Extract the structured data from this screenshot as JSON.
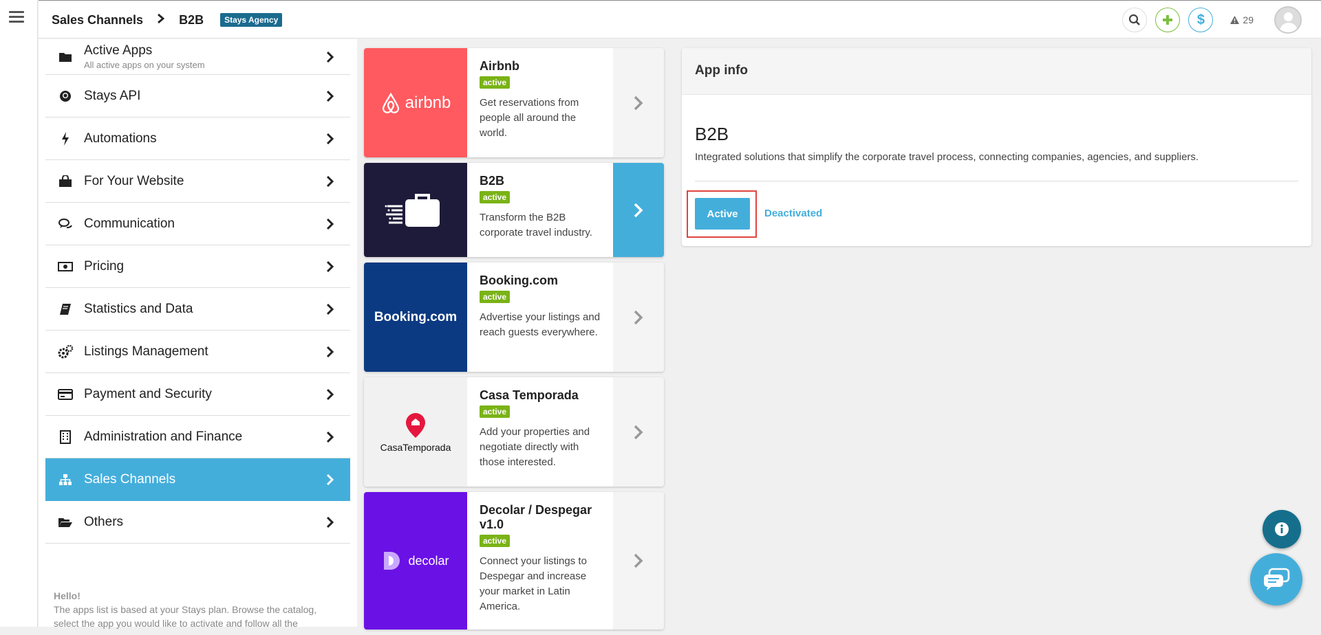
{
  "header": {
    "breadcrumb": [
      "Sales Channels",
      "B2B"
    ],
    "agency_badge": "Stays Agency",
    "alert_count": "29"
  },
  "sidebar": {
    "items": [
      {
        "label": "Active Apps",
        "sub": "All active apps on your system",
        "icon": "folder-icon"
      },
      {
        "label": "Stays API",
        "icon": "github-icon"
      },
      {
        "label": "Automations",
        "icon": "bolt-icon"
      },
      {
        "label": "For Your Website",
        "icon": "shopping-bag-icon"
      },
      {
        "label": "Communication",
        "icon": "chat-bubbles-icon"
      },
      {
        "label": "Pricing",
        "icon": "money-bill-icon"
      },
      {
        "label": "Statistics and Data",
        "icon": "book-icon"
      },
      {
        "label": "Listings Management",
        "icon": "gears-icon"
      },
      {
        "label": "Payment and Security",
        "icon": "credit-card-icon"
      },
      {
        "label": "Administration and Finance",
        "icon": "building-icon"
      },
      {
        "label": "Sales Channels",
        "icon": "sitemap-icon",
        "active": true
      },
      {
        "label": "Others",
        "icon": "folder-open-icon"
      }
    ],
    "hello_title": "Hello!",
    "hello_text": "The apps list is based at your Stays plan. Browse the catalog, select the app you would like to activate and follow all the"
  },
  "apps": [
    {
      "name": "Airbnb",
      "status": "active",
      "desc": "Get reservations from people all around the world.",
      "logo_text": "airbnb",
      "color": "#ff5a5f"
    },
    {
      "name": "B2B",
      "status": "active",
      "desc": "Transform the B2B corporate travel industry.",
      "color": "#1e1b3a",
      "selected": true
    },
    {
      "name": "Booking.com",
      "status": "active",
      "desc": "Advertise your listings and reach guests everywhere.",
      "logo_text": "Booking.com",
      "color": "#0c3a82"
    },
    {
      "name": "Casa Temporada",
      "status": "active",
      "desc": "Add your properties and negotiate directly with those interested.",
      "logo_text": "CasaTemporada",
      "color": "#f1f1f1"
    },
    {
      "name": "Decolar / Despegar v1.0",
      "status": "active",
      "desc": "Connect your listings to Despegar and increase your market in Latin America.",
      "logo_text": "decolar",
      "color": "#6a11e6"
    }
  ],
  "panel": {
    "heading": "App info",
    "title": "B2B",
    "description": "Integrated solutions that simplify the corporate travel process, connecting companies, agencies, and suppliers.",
    "active_label": "Active",
    "deactivated_label": "Deactivated"
  },
  "colors": {
    "accent": "#44aedb",
    "badge_green": "#7ab317",
    "highlight": "#e0443f"
  }
}
